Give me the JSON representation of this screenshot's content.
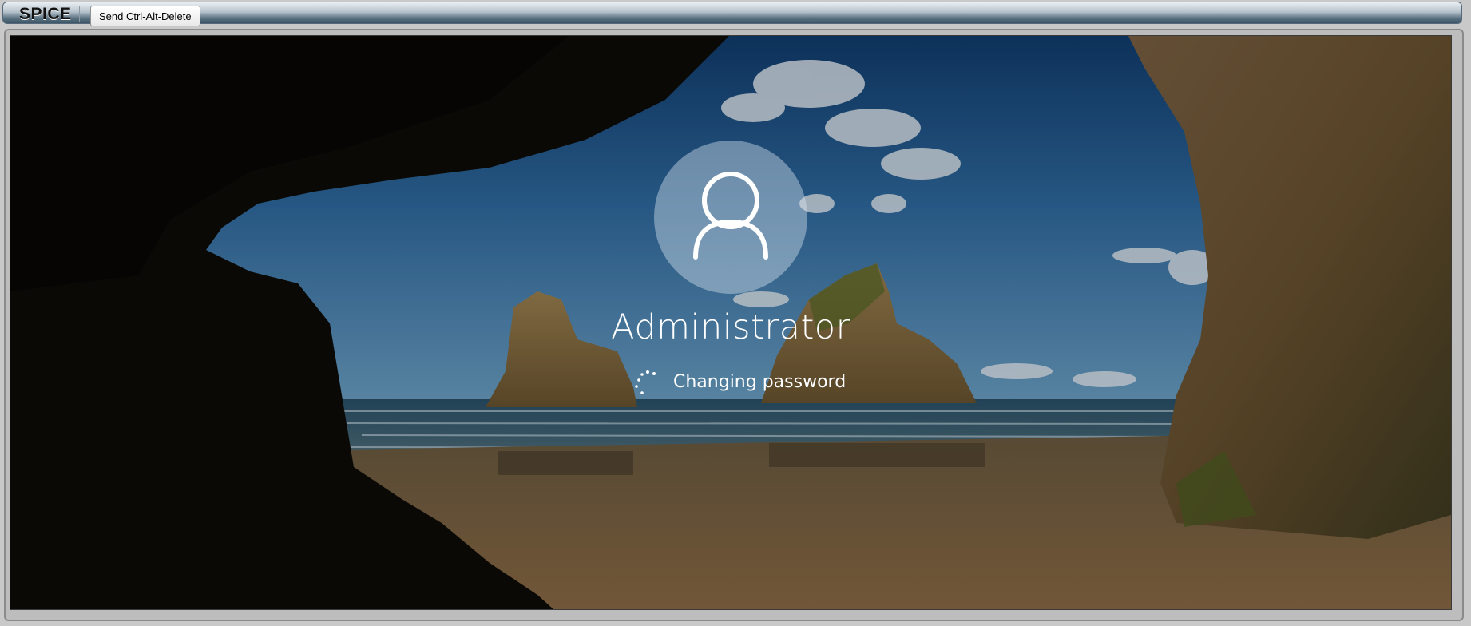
{
  "toolbar": {
    "brand": "SPICE",
    "send_cad_label": "Send Ctrl-Alt-Delete"
  },
  "login": {
    "username": "Administrator",
    "status": "Changing password",
    "avatar_icon": "user-icon",
    "spinner_icon": "loading-spinner-icon"
  },
  "colors": {
    "text": "#ffffff",
    "avatar_bg": "#9db3c4"
  }
}
